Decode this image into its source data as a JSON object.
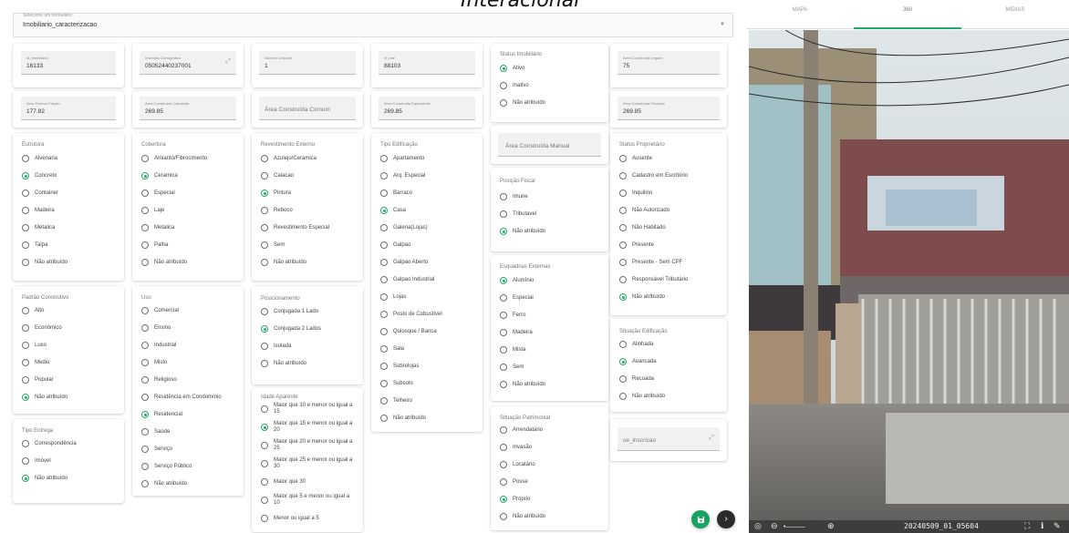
{
  "banner": {
    "text": "Interacional"
  },
  "selector": {
    "label": "Selecione um formulário",
    "value": "Imobiliario_caracterizacao"
  },
  "fields": {
    "id_imobiliario": {
      "label": "Id_Imobiliario",
      "value": "16133"
    },
    "inscricao": {
      "label": "Inscrição Cartográfica",
      "value": "05052440237001"
    },
    "numero_unidade": {
      "label": "Número Unidade",
      "value": "1"
    },
    "id_lote": {
      "label": "Id_lote",
      "value": "88103"
    },
    "area_legado": {
      "label": "Área Construída Legado",
      "value": "75"
    },
    "area_terreno": {
      "label": "Área Terreno Fração",
      "value": "177.82"
    },
    "area_calculada": {
      "label": "Área Construída Calculada",
      "value": "269.85"
    },
    "area_comum": {
      "placeholder": "Área Construída Comum"
    },
    "area_equivalente": {
      "label": "Área Construída Equivalente",
      "value": "269.85"
    },
    "area_privativa": {
      "label": "Área Construída Privativa",
      "value": "269.85"
    },
    "area_manual": {
      "placeholder": "Área Construída Manual"
    },
    "ce_inscricao": {
      "placeholder": "ce_inscricao"
    }
  },
  "groups": {
    "status_imobiliario": {
      "title": "Status Imobiliário",
      "options": [
        "Ativo",
        "Inativo",
        "Não atribuído"
      ]
    },
    "estrutura": {
      "title": "Estrutura",
      "options": [
        "Alvenaria",
        "Concreto",
        "Container",
        "Madeira",
        "Metalica",
        "Taipa",
        "Não atribuído"
      ]
    },
    "cobertura": {
      "title": "Cobertura",
      "options": [
        "Amianto/Fibrocimento",
        "Ceramica",
        "Especial",
        "Laje",
        "Metalica",
        "Palha",
        "Não atribuído"
      ]
    },
    "revestimento": {
      "title": "Revestimento Externo",
      "options": [
        "Azulejo/Ceramica",
        "Caiacao",
        "Pintura",
        "Reboco",
        "Revestimento Especial",
        "Sem",
        "Não atribuído"
      ]
    },
    "tipo_edificacao": {
      "title": "Tipo Edificação",
      "options": [
        "Apartamento",
        "Arq. Especial",
        "Barraco",
        "Casa",
        "Galeria(Lojas)",
        "Galpao",
        "Galpao Aberto",
        "Galpao Industrial",
        "Lojas",
        "Posto de Cobustível",
        "Quiosque / Banca",
        "Sala",
        "Sobrelojas",
        "Subsolo",
        "Telheiro",
        "Não atribuído"
      ]
    },
    "posicao_fiscal": {
      "title": "Posição Fiscal",
      "options": [
        "Imune",
        "Tributavel",
        "Não atribuído"
      ]
    },
    "status_proprietario": {
      "title": "Status Proprietário",
      "options": [
        "Ausente",
        "Cadastro em Escritório",
        "Inquilino",
        "Não Autorizado",
        "Não Habitado",
        "Presente",
        "Presente - Sem CPF",
        "Responsável Tributário",
        "Não atribuído"
      ]
    },
    "padrao_construtivo": {
      "title": "Padrão Construtivo",
      "options": [
        "Alto",
        "Econômico",
        "Luxo",
        "Medio",
        "Popular",
        "Não atribuído"
      ]
    },
    "uso": {
      "title": "Uso",
      "options": [
        "Comercial",
        "Ensino",
        "Industrial",
        "Misto",
        "Religioso",
        "Residência em Condomínio",
        "Residencial",
        "Saúde",
        "Serviço",
        "Serviço Público",
        "Não atribuído"
      ]
    },
    "posicionamento": {
      "title": "Posicionamento",
      "options": [
        "Conjugada 1 Lado",
        "Conjugada 2 Lados",
        "Isolada",
        "Não atribuído"
      ]
    },
    "esquadrias": {
      "title": "Esquadrias Externas",
      "options": [
        "Alumínio",
        "Especial",
        "Ferro",
        "Madeira",
        "Mista",
        "Sem",
        "Não atribuído"
      ]
    },
    "situacao_edificacao": {
      "title": "Situação Edificação",
      "options": [
        "Alinhada",
        "Avancada",
        "Recuada",
        "Não atribuído"
      ]
    },
    "idade_aparente": {
      "title": "Idade Aparente",
      "options": [
        "Maior que 10 e menor ou igual a 15",
        "Maior que 15 e menor ou igual a 20",
        "Maior que 20 e menor ou igual a 25",
        "Maior que 25 e menor ou igual a 30",
        "Maior que 30",
        "Maior que 5 e menor ou igual a 10",
        "Menor ou igual a 5"
      ]
    },
    "tipo_entrega": {
      "title": "Tipo Entrega",
      "options": [
        "Correspondência",
        "Imóvel",
        "Não atribuído"
      ]
    },
    "situacao_patrimonial": {
      "title": "Situação Patrimonial",
      "options": [
        "Arrendatário",
        "Invasão",
        "Locatário",
        "Posse",
        "Próprio",
        "Não atribuído"
      ]
    }
  },
  "selected": {
    "status_imobiliario": "Ativo",
    "estrutura": "Concreto",
    "cobertura": "Ceramica",
    "revestimento": "Pintura",
    "tipo_edificacao": "Casa",
    "posicao_fiscal": "Não atribuído",
    "status_proprietario": "Não atribuído",
    "padrao_construtivo": "Não atribuído",
    "uso": "Residencial",
    "posicionamento": "Conjugada 2 Lados",
    "esquadrias": "Alumínio",
    "situacao_edificacao": "Avancada",
    "idade_aparente": "Maior que 15 e menor ou igual a 20",
    "tipo_entrega": "Não atribuído",
    "situacao_patrimonial": "Próprio"
  },
  "tabs": [
    "MAPA",
    "360",
    "MÍDIAS"
  ],
  "active_tab": "360",
  "photo": {
    "caption": "20240509_01_05604"
  },
  "colors": {
    "accent": "#26a96c",
    "fab_save": "#1aa260",
    "fab_next": "#2b2b2b"
  },
  "icons": {
    "save": "save-icon",
    "next": "chevron-right-icon",
    "expand": "expand-icon",
    "caret": "caret-down-icon"
  }
}
